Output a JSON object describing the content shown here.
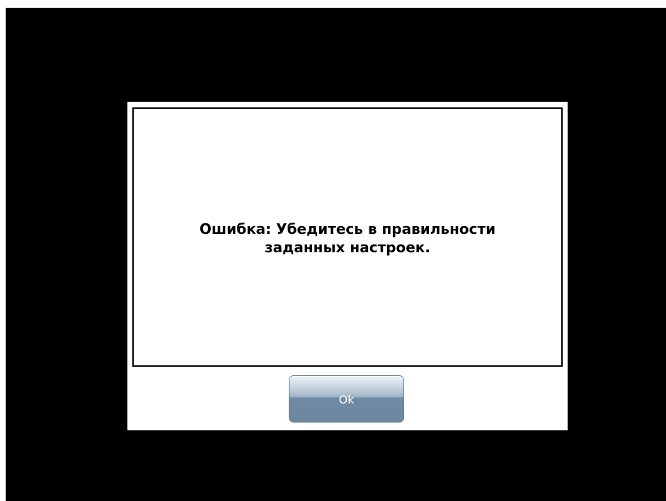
{
  "dialog": {
    "message_line1": "Ошибка: Убедитесь в правильности",
    "message_line2": "заданных настроек.",
    "ok_label": "Ok"
  }
}
